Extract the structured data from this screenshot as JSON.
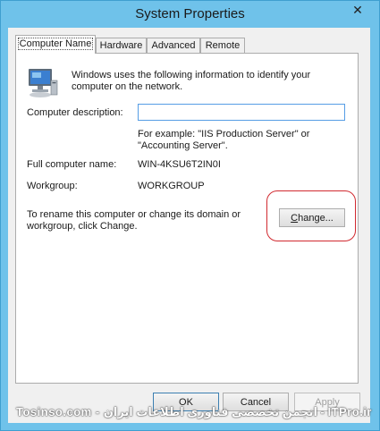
{
  "window": {
    "title": "System Properties",
    "close_glyph": "✕"
  },
  "tabs": [
    {
      "label": "Computer Name",
      "active": true
    },
    {
      "label": "Hardware",
      "active": false
    },
    {
      "label": "Advanced",
      "active": false
    },
    {
      "label": "Remote",
      "active": false
    }
  ],
  "computer_name_tab": {
    "intro_text": "Windows uses the following information to identify your computer on the network.",
    "description_label": "Computer description:",
    "description_value": "",
    "example_text": "For example: \"IIS Production Server\" or \"Accounting Server\".",
    "full_name_label": "Full computer name:",
    "full_name_value": "WIN-4KSU6T2IN0I",
    "workgroup_label": "Workgroup:",
    "workgroup_value": "WORKGROUP",
    "rename_text": "To rename this computer or change its domain or workgroup, click Change.",
    "change_button": {
      "before": "",
      "mnemonic": "C",
      "after": "hange..."
    }
  },
  "footer": {
    "ok_label": "OK",
    "cancel_label": "Cancel",
    "apply_label": "Apply"
  },
  "watermark": "Tosinso.com - انجمن تخصصی فناوری اطلاعات ایران - ITPro.ir",
  "colors": {
    "frame": "#6fc2ea",
    "highlight_ring": "#d12a30",
    "input_border": "#569de5"
  }
}
